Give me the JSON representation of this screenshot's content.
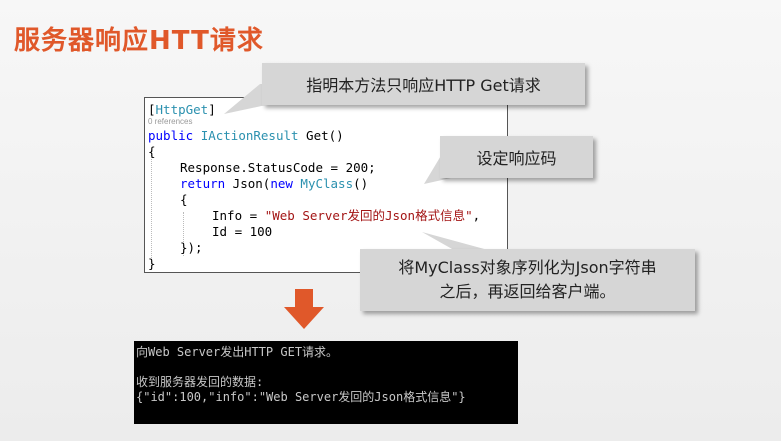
{
  "slide": {
    "title": "服务器响应HTT请求"
  },
  "code": {
    "attribute_open": "[",
    "attribute": "HttpGet",
    "attribute_close": "]",
    "references": "0 references",
    "kw_public": "public",
    "return_type": "IActionResult",
    "method": " Get()",
    "open_brace": "{",
    "status_line": "Response.StatusCode = 200;",
    "kw_return": "return",
    "json_call": " Json(",
    "kw_new": "new",
    "class_name": "MyClass",
    "ctor_tail": "()",
    "inner_open": "{",
    "info_key": "Info = ",
    "info_value": "\"Web Server发回的Json格式信息\"",
    "info_comma": ",",
    "id_line": "Id = 100",
    "inner_close": "});",
    "close_brace": "}"
  },
  "callouts": {
    "get_only": "指明本方法只响应HTTP Get请求",
    "status": "设定响应码",
    "serialize_line1": "将MyClass对象序列化为Json字符串",
    "serialize_line2": "之后，再返回给客户端。"
  },
  "console": {
    "line1": "向Web Server发出HTTP GET请求。",
    "line2": "",
    "line3": "收到服务器发回的数据:",
    "line4": "{\"id\":100,\"info\":\"Web Server发回的Json格式信息\"}"
  },
  "colors": {
    "title": "#e0582a",
    "arrow": "#e0582a",
    "keyword": "#0000ff",
    "type": "#2b91af",
    "string": "#a31515"
  }
}
